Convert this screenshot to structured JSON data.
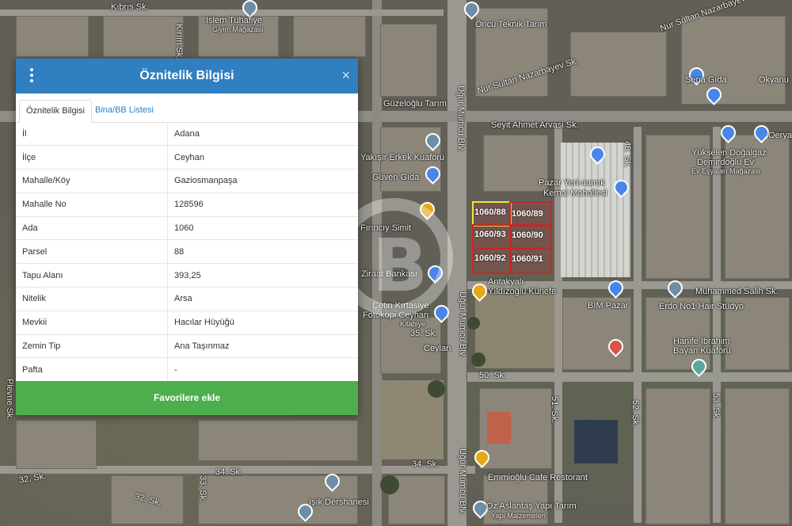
{
  "dialog": {
    "title": "Öznitelik Bilgisi",
    "menu_icon": "vertical-dots-icon",
    "close_icon": "close-icon",
    "close_glyph": "×",
    "tabs": [
      {
        "label": "Öznitelik Bilgisi",
        "active": true
      },
      {
        "label": "Bina/BB Listesi",
        "active": false
      }
    ],
    "rows": [
      {
        "key": "İl",
        "value": "Adana"
      },
      {
        "key": "İlçe",
        "value": "Ceyhan"
      },
      {
        "key": "Mahalle/Köy",
        "value": "Gaziosmanpaşa"
      },
      {
        "key": "Mahalle No",
        "value": "128596"
      },
      {
        "key": "Ada",
        "value": "1060"
      },
      {
        "key": "Parsel",
        "value": "88"
      },
      {
        "key": "Tapu Alanı",
        "value": "393,25"
      },
      {
        "key": "Nitelik",
        "value": "Arsa"
      },
      {
        "key": "Mevkii",
        "value": "Hacılar Hüyüğü"
      },
      {
        "key": "Zemin Tip",
        "value": "Ana Taşınmaz"
      },
      {
        "key": "Pafta",
        "value": "-"
      }
    ],
    "favorite_button": "Favorilere ekle"
  },
  "map": {
    "labels": {
      "kibris": "Kıbrıs Sk.",
      "islem": "İslem Tuhafiye",
      "islem_sub": "Giyim Mağazası",
      "oncu": "Öncü Teknik Tarım",
      "nursultan1": "Nur Sultan Nazarbayev Sk.",
      "nursultan2": "Nur Sultan Nazarbayev Sk.",
      "okyanus": "Okyanu",
      "sena": "Sena Gıda",
      "guzeloglu": "Güzeloğlu Tarım",
      "seyit": "Seyit Ahmet Arvasi Sk.",
      "oerya": "Oerya",
      "yuksel1": "Yükselen Doğalgaz",
      "yuksel2": "Demirdoğlu Ev",
      "yuksel3": "Ev Eşyaları Mağazası",
      "yakisir": "Yakışır Erkek Kuaförü",
      "guven": "Güven Gıda",
      "pazar1": "Pazar Yeri-namık",
      "pazar2": "Kemal Mahallesi",
      "sk48": "48. Sk.",
      "firinci": "Fırıncıy Simit",
      "ugur1": "Uğur Mumcu Blv.",
      "ugur2": "Uğur Mumcu Blv.",
      "ugur3": "Uğur Mumcu Blv.",
      "ziraat": "Ziraat Bankası",
      "antakya1": "Antakyalı",
      "antakya2": "Yıldızoğlu Künefe",
      "muhammed": "Muhammed Salih Sk.",
      "bim": "BİM Pazar",
      "erdo": "Erdo No1 Hair Stüdyo",
      "cetin1": "Çetin Kırtasiye",
      "cetin2": "Fotokopi Ceyhan",
      "cetin3": "Kitabiye",
      "sk35": "35. Sk.",
      "hanife1": "Hanife İbrahim",
      "hanife2": "Bayan Kuaförü",
      "ceylan": "Ceylan",
      "sk50": "50. Sk.",
      "sk51": "51. Sk.",
      "sk52": "52. Sk.",
      "sk53": "53. Sk.",
      "plevne": "Plevne Sk.",
      "kirlim": "Kırım Sk.",
      "sk32": "32. Sk.",
      "sk34a": "34. Sk.",
      "sk34b": "34. Sk.",
      "sk32b": "32. Sk.",
      "sk33": "33. Sk.",
      "emmioglu": "Emmioğlu Cafe Restorant",
      "isik": "Işık Dershanesi",
      "ozaslan1": "Öz Aslantaş Yapı Tarım",
      "ozaslan2": "Yapı Malzemeleri"
    },
    "parcels": [
      {
        "label": "1060/88",
        "highlight": true
      },
      {
        "label": "1060/89"
      },
      {
        "label": "1060/93"
      },
      {
        "label": "1060/90"
      },
      {
        "label": "1060/92"
      },
      {
        "label": "1060/91"
      }
    ]
  }
}
